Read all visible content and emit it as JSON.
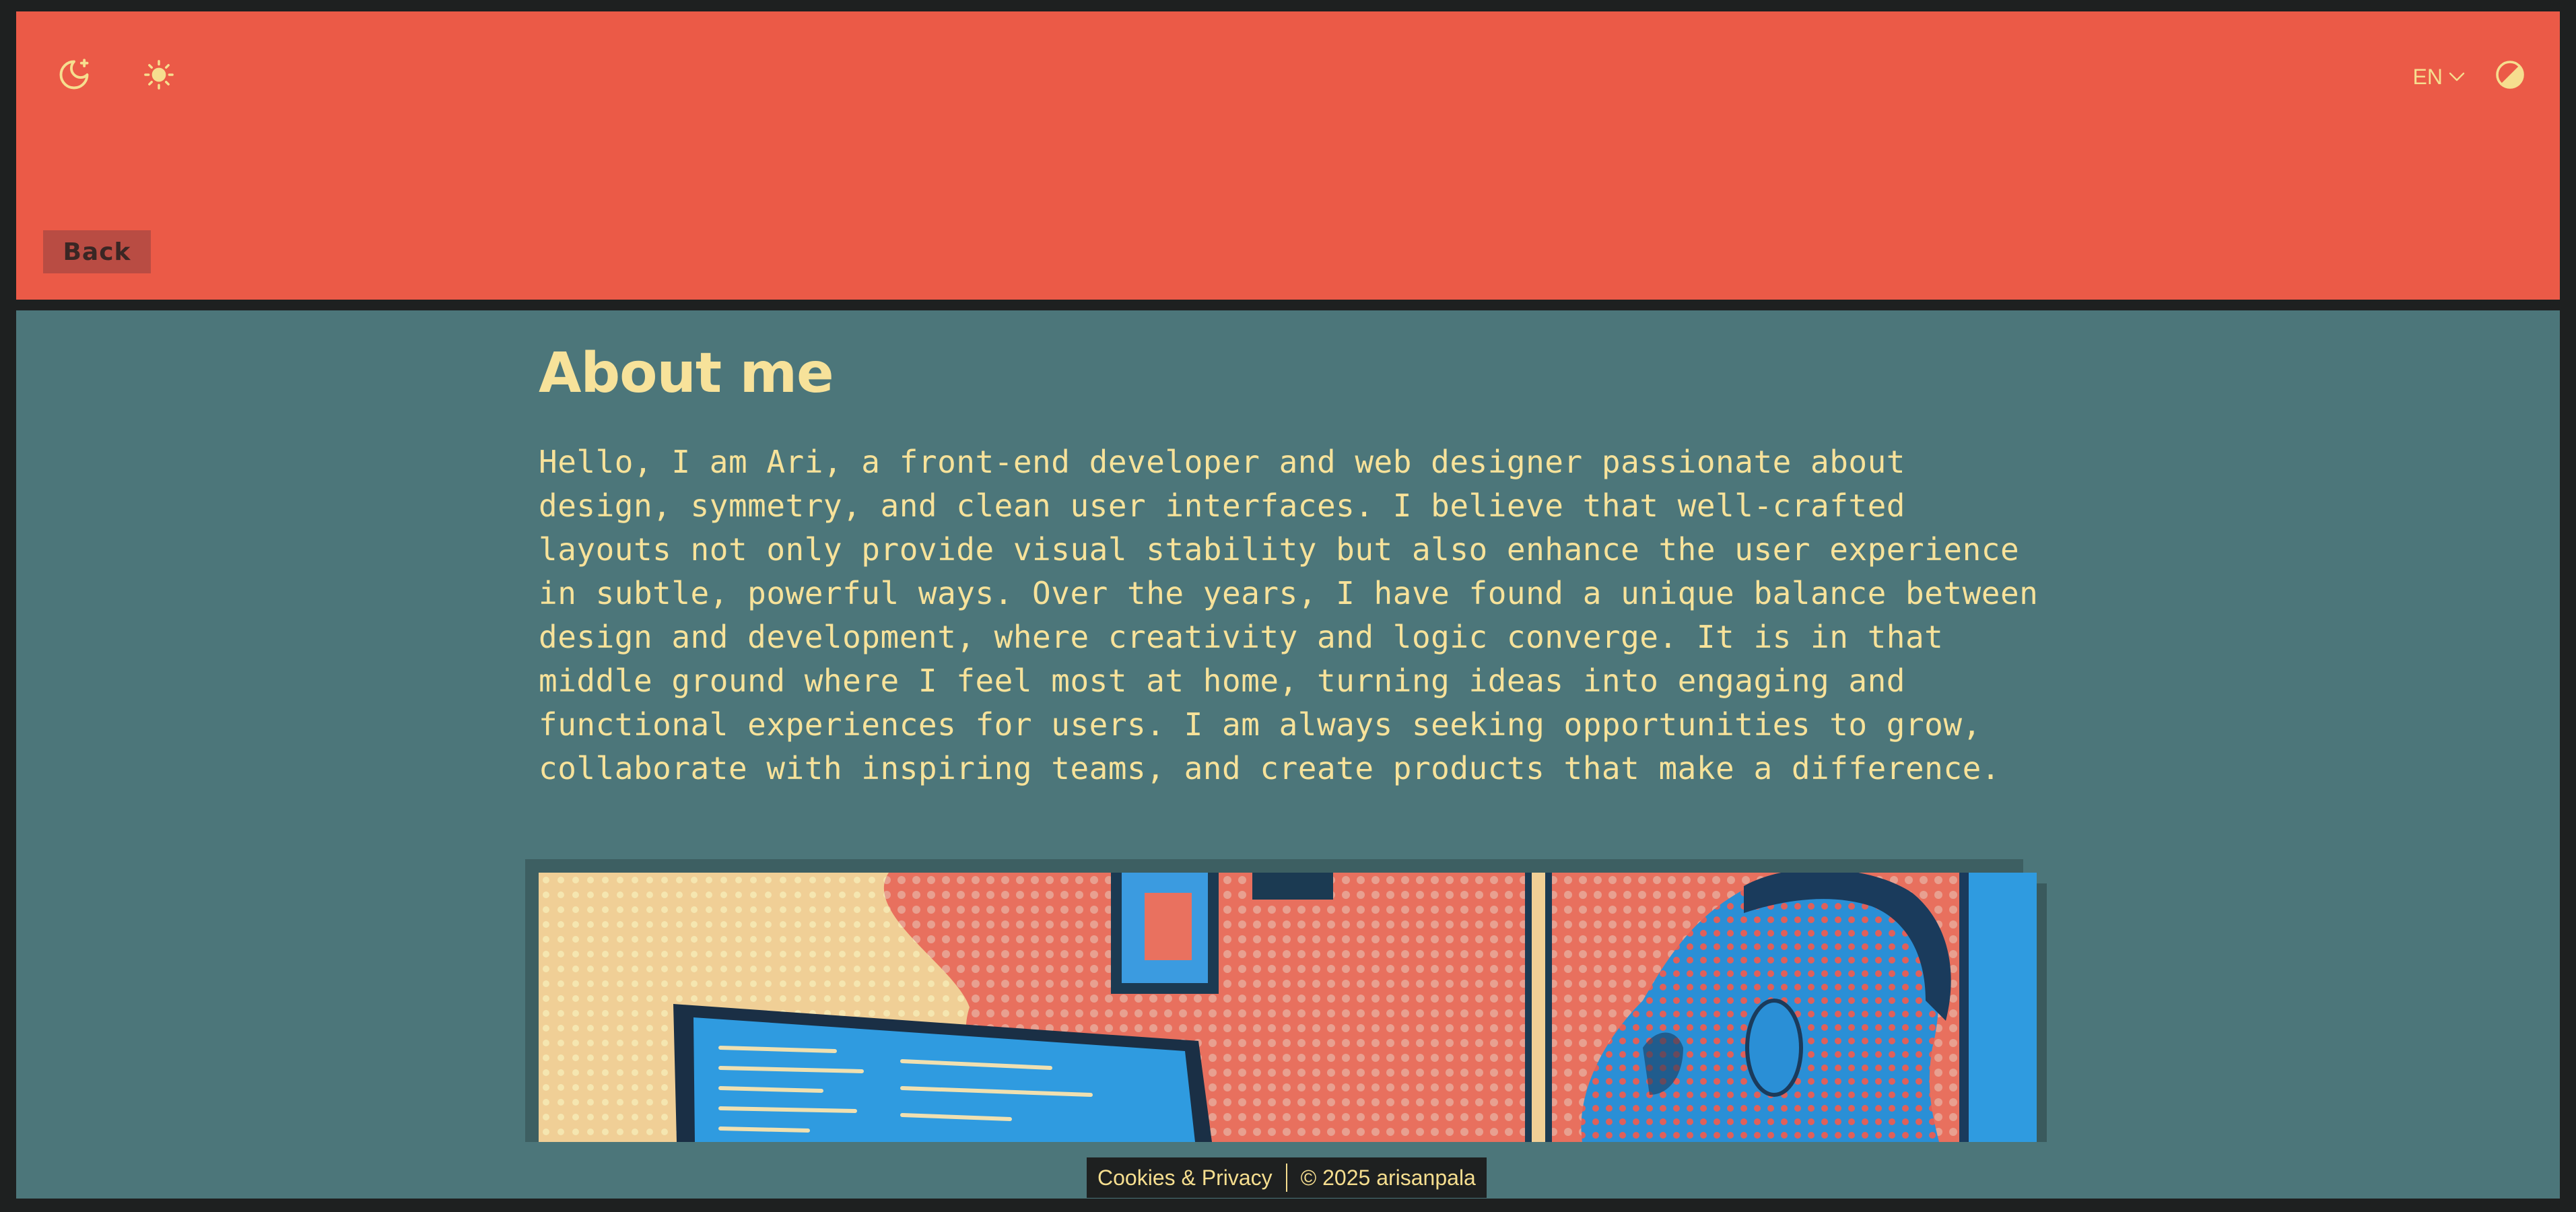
{
  "header": {
    "moon_icon": "moon-stars-icon",
    "sun_icon": "sun-icon",
    "language": "EN",
    "contrast_icon": "contrast-icon",
    "back_label": "Back"
  },
  "main": {
    "title": "About me",
    "bio": "Hello, I am Ari, a front-end developer and web designer passionate about design, symmetry, and clean user interfaces. I believe that well-crafted layouts not only provide visual stability but also enhance the user experience in subtle, powerful ways. Over the years, I have found a unique balance between design and development, where creativity and logic converge. It is in that middle ground where I feel most at home, turning ideas into engaging and functional experiences for users. I am always seeking opportunities to grow, collaborate with inspiring teams, and create products that make a difference."
  },
  "footer": {
    "cookies_label": "Cookies & Privacy",
    "copyright": "© 2025 arisanpala"
  },
  "colors": {
    "header_bg": "#eb5a47",
    "main_bg": "#4c767a",
    "accent_text": "#f7e29a",
    "frame_bg": "#1e2020"
  }
}
